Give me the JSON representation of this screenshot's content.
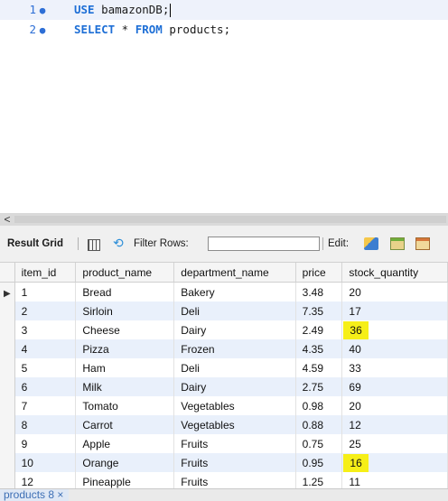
{
  "editor": {
    "lines": [
      {
        "num": "1",
        "kw": "USE",
        "rest": " bamazonDB;"
      },
      {
        "num": "2",
        "kw1": "SELECT",
        "mid": " * ",
        "kw2": "FROM",
        "rest": " products;"
      }
    ]
  },
  "toolbar": {
    "result_grid_label": "Result Grid",
    "filter_label": "Filter Rows:",
    "filter_value": "",
    "edit_label": "Edit:"
  },
  "grid": {
    "columns": [
      "item_id",
      "product_name",
      "department_name",
      "price",
      "stock_quantity"
    ],
    "rows": [
      [
        "1",
        "Bread",
        "Bakery",
        "3.48",
        "20"
      ],
      [
        "2",
        "Sirloin",
        "Deli",
        "7.35",
        "17"
      ],
      [
        "3",
        "Cheese",
        "Dairy",
        "2.49",
        "36"
      ],
      [
        "4",
        "Pizza",
        "Frozen",
        "4.35",
        "40"
      ],
      [
        "5",
        "Ham",
        "Deli",
        "4.59",
        "33"
      ],
      [
        "6",
        "Milk",
        "Dairy",
        "2.75",
        "69"
      ],
      [
        "7",
        "Tomato",
        "Vegetables",
        "0.98",
        "20"
      ],
      [
        "8",
        "Carrot",
        "Vegetables",
        "0.88",
        "12"
      ],
      [
        "9",
        "Apple",
        "Fruits",
        "0.75",
        "25"
      ],
      [
        "10",
        "Orange",
        "Fruits",
        "0.95",
        "16"
      ],
      [
        "12",
        "Pineapple",
        "Fruits",
        "1.25",
        "11"
      ]
    ],
    "highlighted_stock_cells": [
      "36",
      "16"
    ],
    "highlight_color": "#f6ef18"
  },
  "tab": {
    "label": "products 8",
    "close_glyph": "×"
  },
  "colors": {
    "keyword": "#1e6fd6",
    "alt_row": "#e9f0fb",
    "line_number": "#2e6fd6"
  }
}
